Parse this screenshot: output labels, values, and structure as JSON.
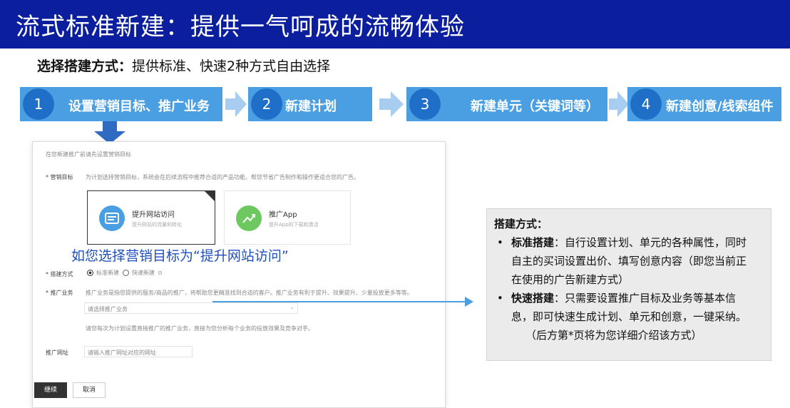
{
  "title": "流式标准新建：提供一气呵成的流畅体验",
  "subtitle": {
    "bold": "选择搭建方式：",
    "rest": "提供标准、快速2种方式自由选择"
  },
  "steps": [
    {
      "num": "1",
      "label": "设置营销目标、推广业务"
    },
    {
      "num": "2",
      "label": "新建计划"
    },
    {
      "num": "3",
      "label": "新建单元（关键词等）"
    },
    {
      "num": "4",
      "label": "新建创意/线索组件"
    }
  ],
  "colors": {
    "title_bg": "#0b1f9e",
    "step_bg": "#4a9fe3",
    "step_num_bg": "#1f6fc9",
    "arrow": "#a8cdf0",
    "note": "#1f4fc0"
  },
  "form": {
    "header": "在您新建推广前请先设置营销目标",
    "goal_label": "* 营销目标",
    "goal_hint": "为计划选择营销目标，系统会在后续流程中推荐合适的产品功能、帮您节省广告制作和操作更适合您的广告。",
    "options": [
      {
        "title": "提升网站访问",
        "desc": "提升网站的流量和转化",
        "icon": "website-icon"
      },
      {
        "title": "推广App",
        "desc": "提升App的下载和激活",
        "icon": "app-icon"
      }
    ],
    "mode_label": "* 搭建方式",
    "mode_options": [
      "标准新建",
      "快速新建"
    ],
    "business_label": "* 推广业务",
    "business_hint": "推广业务是指您提供的服务/商品的推广，将帮助您更精准找到合适的客户。推广业务有利于提升、效果提升、少量投放更多等等。",
    "business_placeholder": "请选择推广业务",
    "business_note": "请您每次为计划设置直接推广的推广业务，直接为您分析每个业务的投放效果及竞争对手。",
    "url_label": "推广网址",
    "url_placeholder": "请输入推广网址对应的网址",
    "next_button": "继续",
    "cancel_button": "取消"
  },
  "overlay_note": "如您选择营销目标为“提升网站访问”",
  "info": {
    "heading": "搭建方式：",
    "items": [
      {
        "bold": "标准搭建",
        "lines": [
          "：自行设置计划、单元的各种属性，同时",
          "自主的买词设置出价、填写创意内容（即您当前正",
          "在使用的广告新建方式）"
        ]
      },
      {
        "bold": "快速搭建",
        "lines": [
          "：只需要设置推广目标及业务等基本信",
          "息，即可快速生成计划、单元和创意，一键采纳。"
        ]
      }
    ],
    "trailing": "（后方第*页将为您详细介绍该方式）"
  }
}
